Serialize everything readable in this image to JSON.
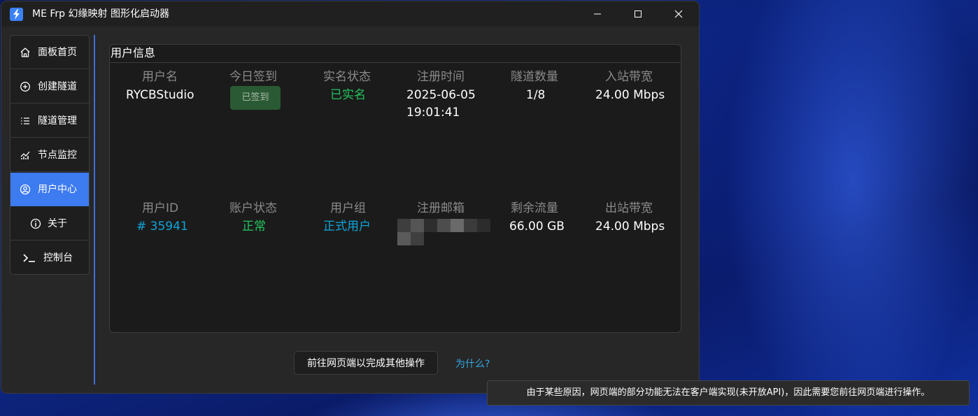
{
  "window": {
    "title": "ME Frp 幻缘映射 图形化启动器",
    "icons": {
      "app": "lightning-bolt-icon",
      "minimize": "minimize-icon",
      "maximize": "maximize-icon",
      "close": "close-icon"
    }
  },
  "sidebar": {
    "items": [
      {
        "label": "面板首页",
        "icon": "home-icon",
        "active": false
      },
      {
        "label": "创建隧道",
        "icon": "plus-circle-icon",
        "active": false
      },
      {
        "label": "隧道管理",
        "icon": "list-icon",
        "active": false
      },
      {
        "label": "节点监控",
        "icon": "chart-icon",
        "active": false
      },
      {
        "label": "用户中心",
        "icon": "user-circle-icon",
        "active": true
      },
      {
        "label": "关于",
        "icon": "info-icon",
        "active": false
      },
      {
        "label": "控制台",
        "icon": "terminal-icon",
        "active": false
      }
    ]
  },
  "user_info": {
    "title": "用户信息",
    "row1": [
      {
        "label": "用户名",
        "value": "RYCBStudio"
      },
      {
        "label": "今日签到",
        "value": "已签到"
      },
      {
        "label": "实名状态",
        "value": "已实名"
      },
      {
        "label": "注册时间",
        "value_date": "2025-06-05",
        "value_time": "19:01:41"
      },
      {
        "label": "隧道数量",
        "value": "1/8"
      },
      {
        "label": "入站带宽",
        "value": "24.00 Mbps"
      }
    ],
    "row2": [
      {
        "label": "用户ID",
        "value": "# 35941"
      },
      {
        "label": "账户状态",
        "value": "正常"
      },
      {
        "label": "用户组",
        "value": "正式用户"
      },
      {
        "label": "注册邮箱",
        "value": ""
      },
      {
        "label": "剩余流量",
        "value": "66.00 GB"
      },
      {
        "label": "出站带宽",
        "value": "24.00 Mbps"
      }
    ]
  },
  "actions": {
    "web_button": "前往网页端以完成其他操作",
    "why_link": "为什么?"
  },
  "tooltip": {
    "text": "由于某些原因，网页端的部分功能无法在客户端实现(未开放API)，因此需要您前往网页端进行操作。"
  },
  "colors": {
    "accent": "#3d7bf0",
    "success": "#22c55e",
    "info": "#0ea5d9",
    "link": "#32a7e0"
  }
}
